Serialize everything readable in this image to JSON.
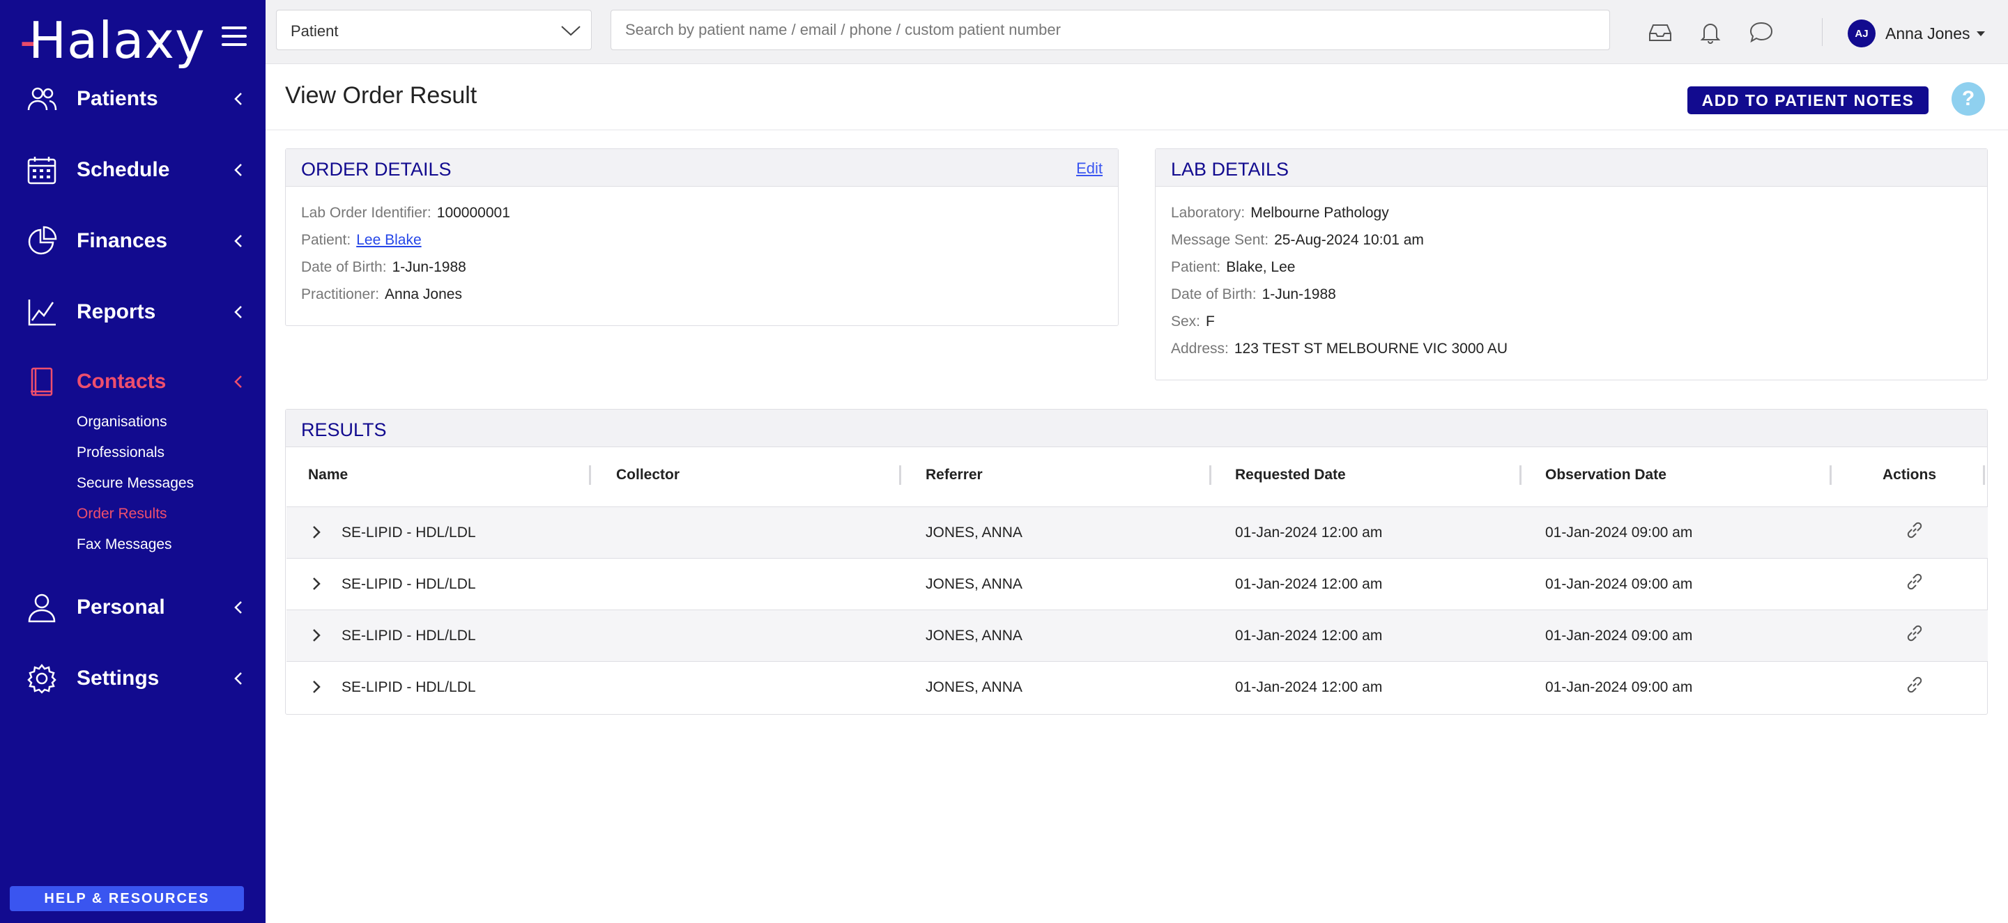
{
  "app": {
    "logo": "Halaxy",
    "colors": {
      "brand": "#120b8f",
      "accent": "#ee4f6d",
      "link": "#2546e8"
    }
  },
  "sidebar": {
    "items": [
      {
        "label": "Patients",
        "icon": "patients-icon"
      },
      {
        "label": "Schedule",
        "icon": "calendar-icon"
      },
      {
        "label": "Finances",
        "icon": "pie-chart-icon"
      },
      {
        "label": "Reports",
        "icon": "line-chart-icon"
      },
      {
        "label": "Contacts",
        "icon": "address-book-icon",
        "active": true
      },
      {
        "label": "Personal",
        "icon": "person-icon"
      },
      {
        "label": "Settings",
        "icon": "gear-icon"
      }
    ],
    "contacts_subitems": [
      {
        "label": "Organisations"
      },
      {
        "label": "Professionals"
      },
      {
        "label": "Secure Messages"
      },
      {
        "label": "Order Results",
        "active": true
      },
      {
        "label": "Fax Messages"
      }
    ],
    "help_label": "HELP & RESOURCES"
  },
  "topbar": {
    "patient_select_value": "Patient",
    "search_placeholder": "Search by patient name / email / phone / custom patient number",
    "user": {
      "initials": "AJ",
      "name": "Anna Jones"
    }
  },
  "page": {
    "title": "View Order Result",
    "add_notes_label": "ADD TO PATIENT NOTES",
    "help_symbol": "?"
  },
  "order_details": {
    "title": "ORDER DETAILS",
    "edit_label": "Edit",
    "fields": [
      {
        "label": "Lab Order Identifier:",
        "value": "100000001"
      },
      {
        "label": "Patient:",
        "value": "Lee Blake"
      },
      {
        "label": "Date of Birth:",
        "value": "1-Jun-1988"
      },
      {
        "label": "Practitioner:",
        "value": "Anna Jones"
      }
    ]
  },
  "lab_details": {
    "title": "LAB DETAILS",
    "fields": [
      {
        "label": "Laboratory:",
        "value": "Melbourne Pathology"
      },
      {
        "label": "Message Sent:",
        "value": "25-Aug-2024 10:01 am"
      },
      {
        "label": "Patient:",
        "value": "Blake, Lee"
      },
      {
        "label": "Date of Birth:",
        "value": "1-Jun-1988"
      },
      {
        "label": "Sex:",
        "value": "F"
      },
      {
        "label": "Address:",
        "value": "123 TEST ST MELBOURNE VIC 3000 AU"
      }
    ]
  },
  "results": {
    "title": "RESULTS",
    "columns": [
      "Name",
      "Collector",
      "Referrer",
      "Requested Date",
      "Observation Date",
      "Actions"
    ],
    "rows": [
      {
        "name": "SE-LIPID - HDL/LDL",
        "collector": "",
        "referrer": "JONES, ANNA",
        "requested": "01-Jan-2024 12:00 am",
        "observed": "01-Jan-2024 09:00 am"
      },
      {
        "name": "SE-LIPID - HDL/LDL",
        "collector": "",
        "referrer": "JONES, ANNA",
        "requested": "01-Jan-2024 12:00 am",
        "observed": "01-Jan-2024 09:00 am"
      },
      {
        "name": "SE-LIPID - HDL/LDL",
        "collector": "",
        "referrer": "JONES, ANNA",
        "requested": "01-Jan-2024 12:00 am",
        "observed": "01-Jan-2024 09:00 am"
      },
      {
        "name": "SE-LIPID - HDL/LDL",
        "collector": "",
        "referrer": "JONES, ANNA",
        "requested": "01-Jan-2024 12:00 am",
        "observed": "01-Jan-2024 09:00 am"
      }
    ]
  }
}
